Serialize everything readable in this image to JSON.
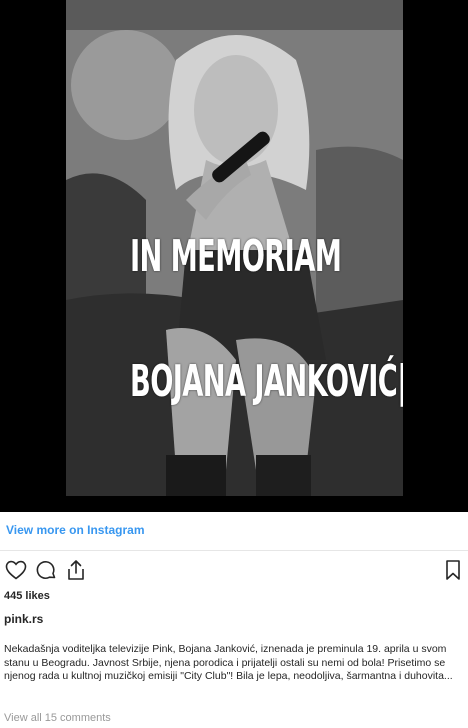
{
  "media": {
    "overlay_line1": "IN MEMORIAM",
    "overlay_line2": "BOJANA JANKOVIĆ|"
  },
  "links": {
    "view_more": "View more on Instagram"
  },
  "actions": {
    "icons": [
      "heart-icon",
      "comment-icon",
      "share-icon",
      "bookmark-icon"
    ]
  },
  "post": {
    "likes": "445 likes",
    "username": "pink.rs",
    "caption": "Nekadašnja voditeljka televizije Pink, Bojana Janković, iznenada je preminula 19. aprila u svom stanu u Beogradu. Javnost Srbije, njena porodica i prijatelji ostali su nemi od bola! Prisetimo se njenog rada u kultnoj muzičkoj emisiji \"City Club\"! Bila je lepa, neodoljiva, šarmantna i duhovita...",
    "view_comments": "View all 15 comments"
  },
  "colors": {
    "link": "#3897f0",
    "text": "#262626",
    "muted": "#999999",
    "media_bg": "#000000"
  }
}
